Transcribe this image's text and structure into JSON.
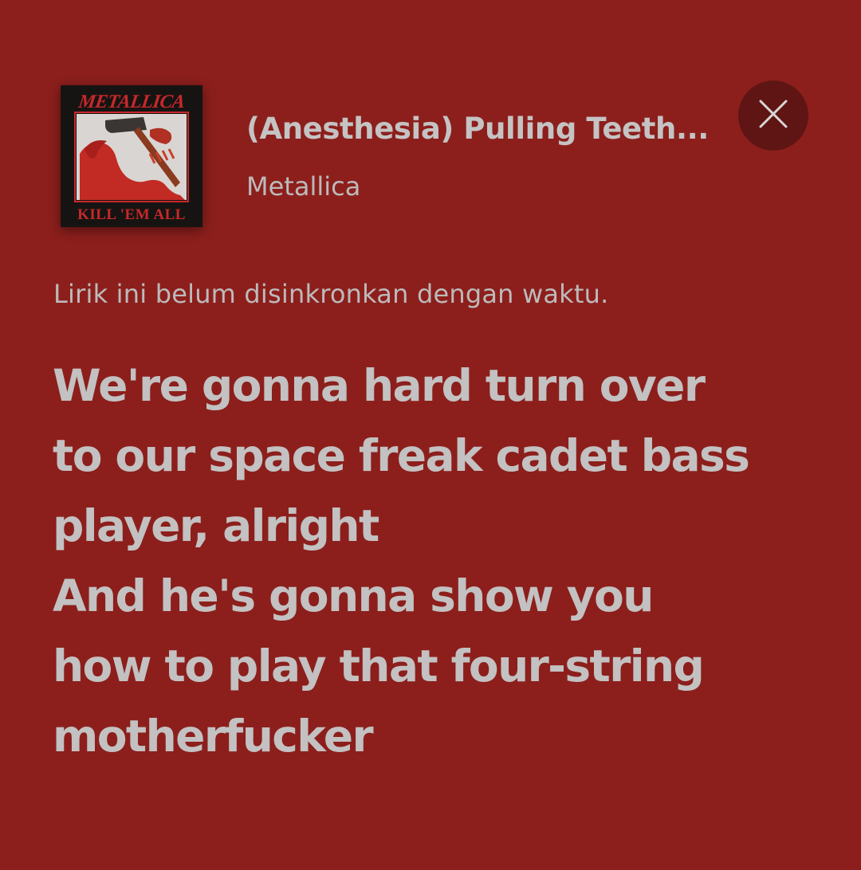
{
  "album": {
    "band_logo": "METALLICA",
    "album_title": "KILL 'EM ALL"
  },
  "track": {
    "title": "(Anesthesia) Pulling Teeth...",
    "artist": "Metallica"
  },
  "close_icon": "close-icon",
  "sync_note": "Lirik ini belum disinkronkan dengan waktu.",
  "lyrics": [
    "We're gonna hard turn over",
    "to our space freak cadet bass",
    "player, alright",
    "And he's gonna show you",
    "how to play that four-string",
    "motherfucker"
  ],
  "colors": {
    "background": "#8c1f1c",
    "close_button_bg": "#5f1513",
    "text": "#c3c1c1"
  }
}
